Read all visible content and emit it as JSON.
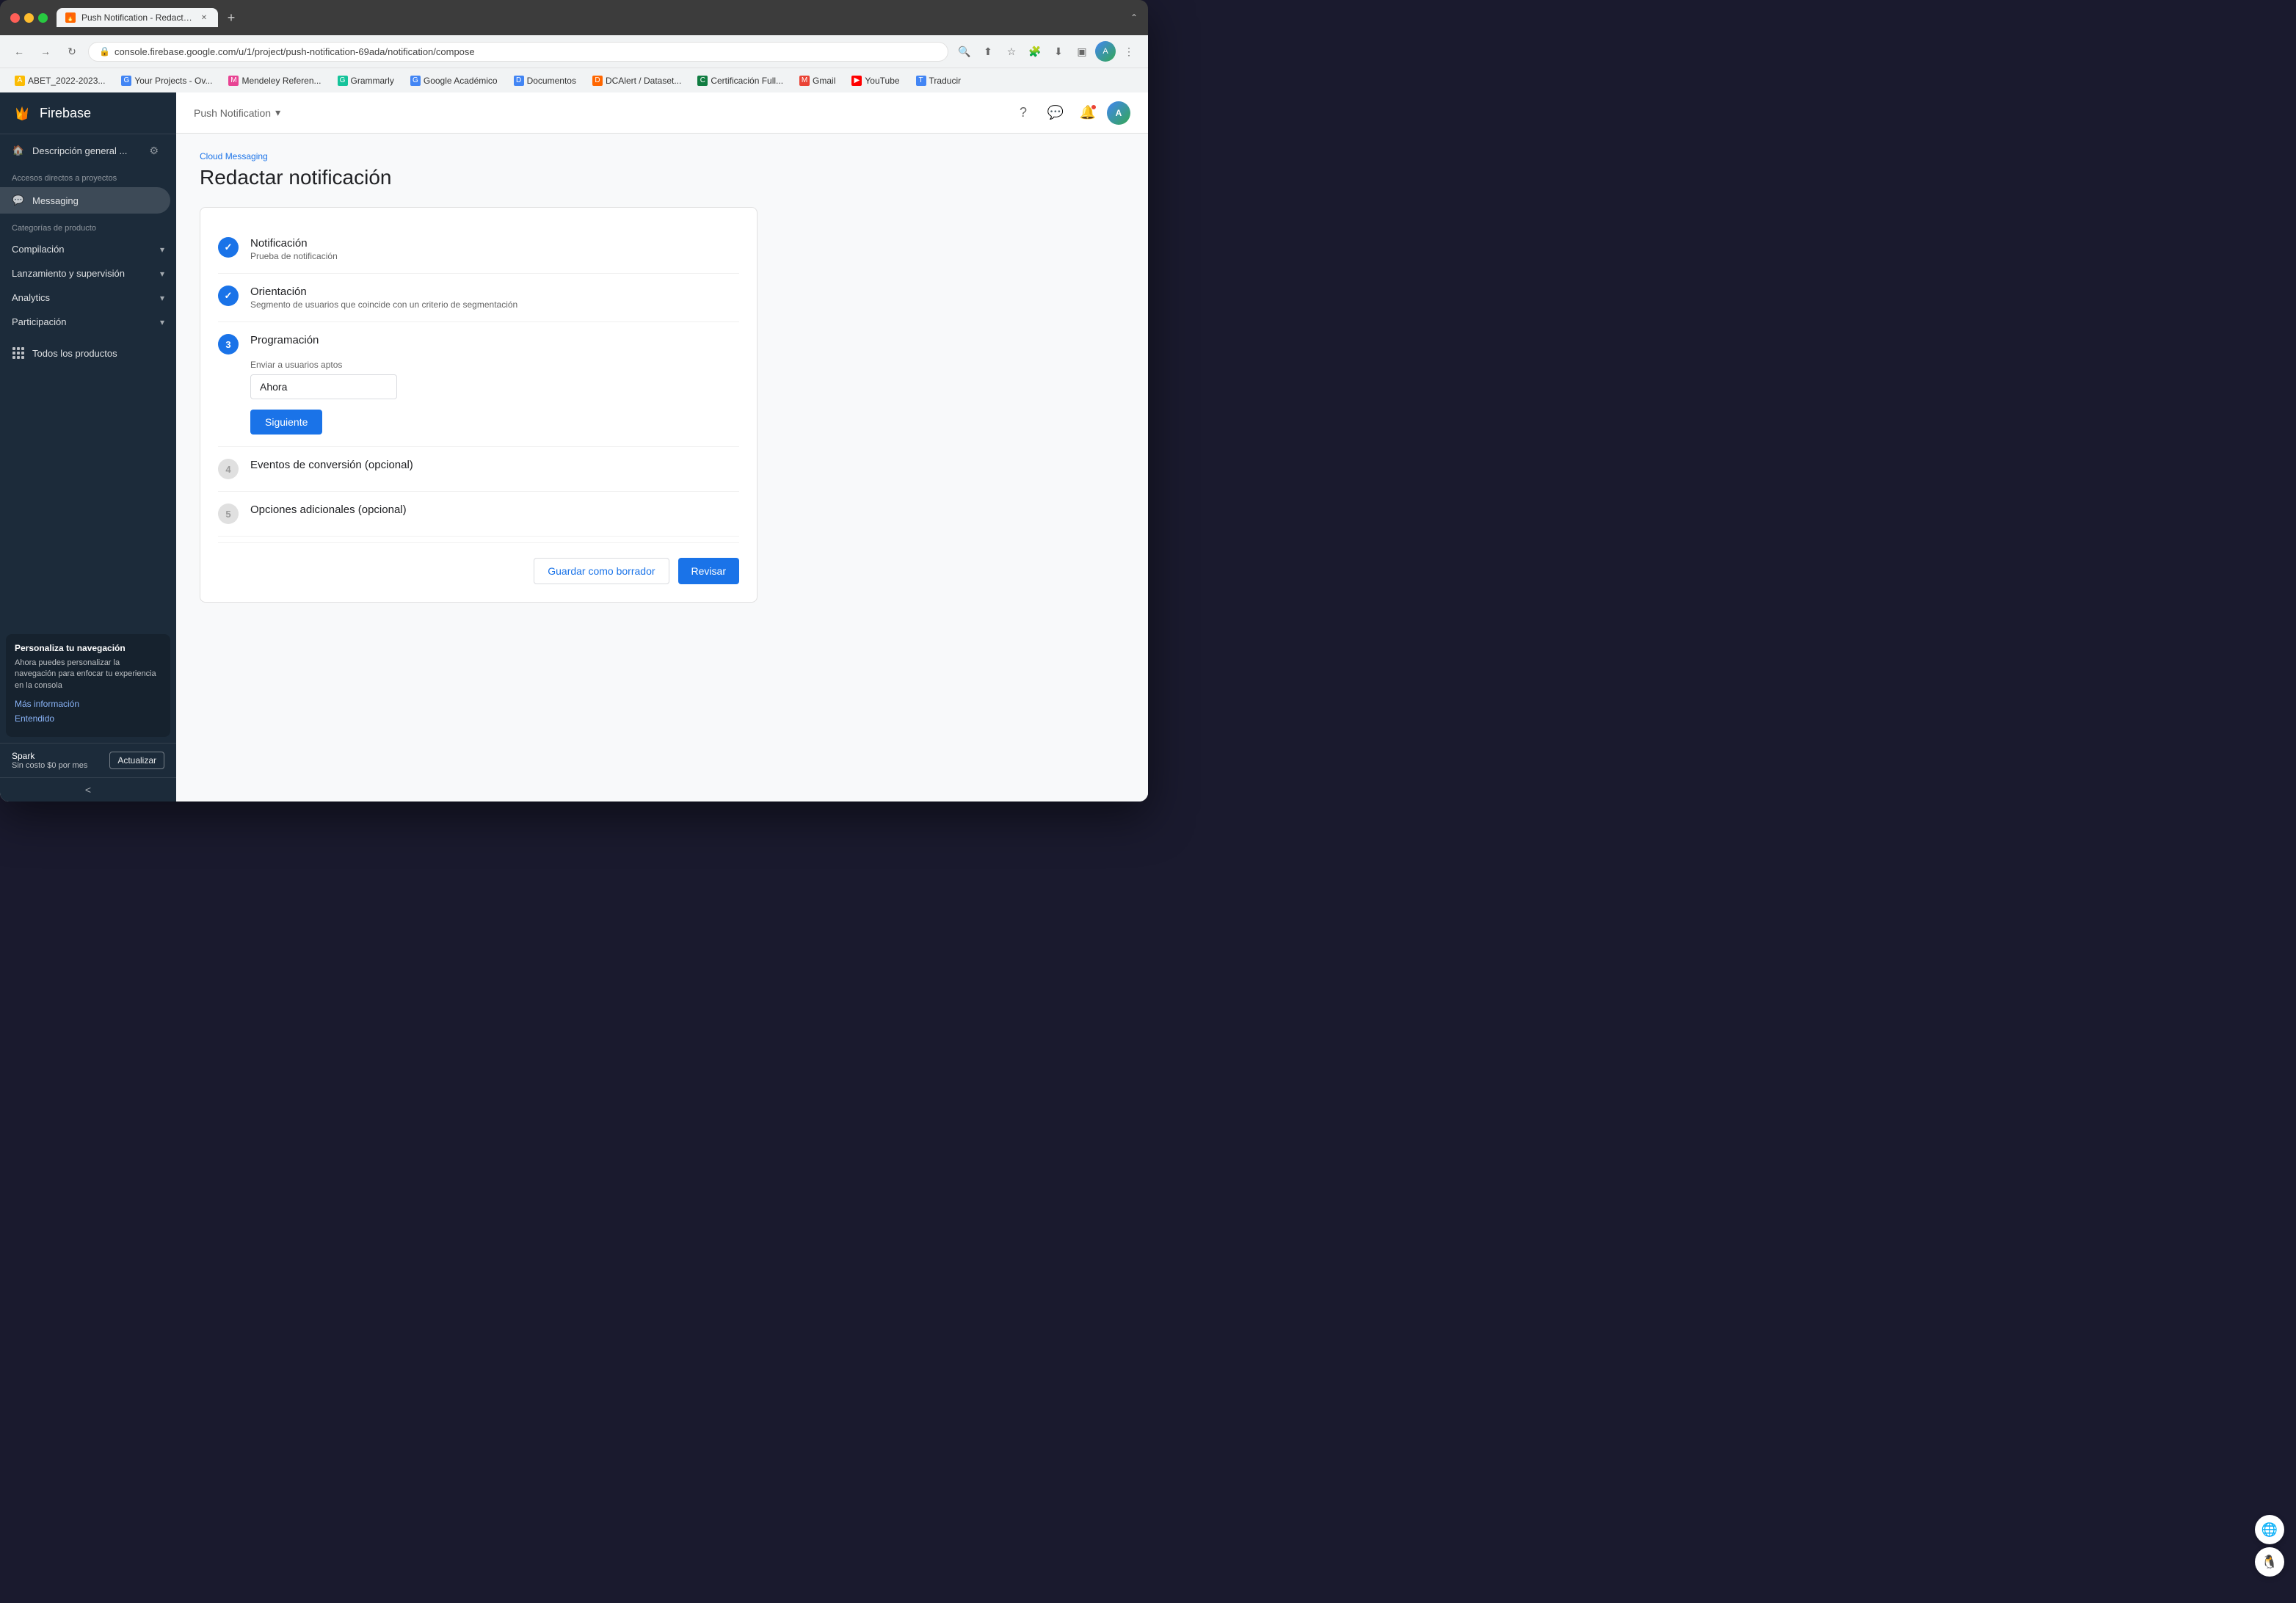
{
  "browser": {
    "tab_title": "Push Notification - Redactar n...",
    "url": "console.firebase.google.com/u/1/project/push-notification-69ada/notification/compose",
    "new_tab_label": "+",
    "back_btn": "←",
    "forward_btn": "→",
    "reload_btn": "↻"
  },
  "bookmarks": [
    {
      "label": "ABET_2022-2023...",
      "color": "#fbbc04"
    },
    {
      "label": "Your Projects - Ov...",
      "color": "#4285f4"
    },
    {
      "label": "Mendeley Referen...",
      "color": "#e84393"
    },
    {
      "label": "Grammarly",
      "color": "#15c39a"
    },
    {
      "label": "Google Académico",
      "color": "#4285f4"
    },
    {
      "label": "Documentos",
      "color": "#4285f4"
    },
    {
      "label": "DCAlert / Dataset...",
      "color": "#ff6600"
    },
    {
      "label": "Certificación Full...",
      "color": "#107c41"
    },
    {
      "label": "Gmail",
      "color": "#ea4335"
    },
    {
      "label": "YouTube",
      "color": "#ff0000"
    },
    {
      "label": "Traducir",
      "color": "#4285f4"
    }
  ],
  "sidebar": {
    "app_name": "Firebase",
    "home_label": "Descripción general ...",
    "accesos_label": "Accesos directos a proyectos",
    "messaging_label": "Messaging",
    "categorias_label": "Categorías de producto",
    "compilacion_label": "Compilación",
    "lanzamiento_label": "Lanzamiento y supervisión",
    "analytics_label": "Analytics",
    "participacion_label": "Participación",
    "products_label": "Todos los productos",
    "customize_title": "Personaliza tu navegación",
    "customize_desc": "Ahora puedes personalizar la navegación para enfocar tu experiencia en la consola",
    "mas_info_label": "Más información",
    "entendido_label": "Entendido",
    "spark_plan": "Spark",
    "spark_price": "Sin costo $0 por mes",
    "upgrade_label": "Actualizar",
    "collapse_label": "<"
  },
  "header": {
    "breadcrumb_project": "Push Notification",
    "breadcrumb_dropdown": "▾",
    "page_subtitle": "Cloud Messaging",
    "page_title": "Redactar notificación"
  },
  "form": {
    "step1": {
      "number": "✓",
      "title": "Notificación",
      "subtitle": "Prueba de notificación"
    },
    "step2": {
      "number": "✓",
      "title": "Orientación",
      "subtitle": "Segmento de usuarios que coincide con un criterio de segmentación"
    },
    "step3": {
      "number": "3",
      "title": "Programación",
      "field_label": "Enviar a usuarios aptos",
      "field_value": "Ahora",
      "siguiente_label": "Siguiente"
    },
    "step4": {
      "number": "4",
      "title": "Eventos de conversión (opcional)"
    },
    "step5": {
      "number": "5",
      "title": "Opciones adicionales (opcional)"
    },
    "footer": {
      "save_draft_label": "Guardar como borrador",
      "review_label": "Revisar"
    }
  }
}
